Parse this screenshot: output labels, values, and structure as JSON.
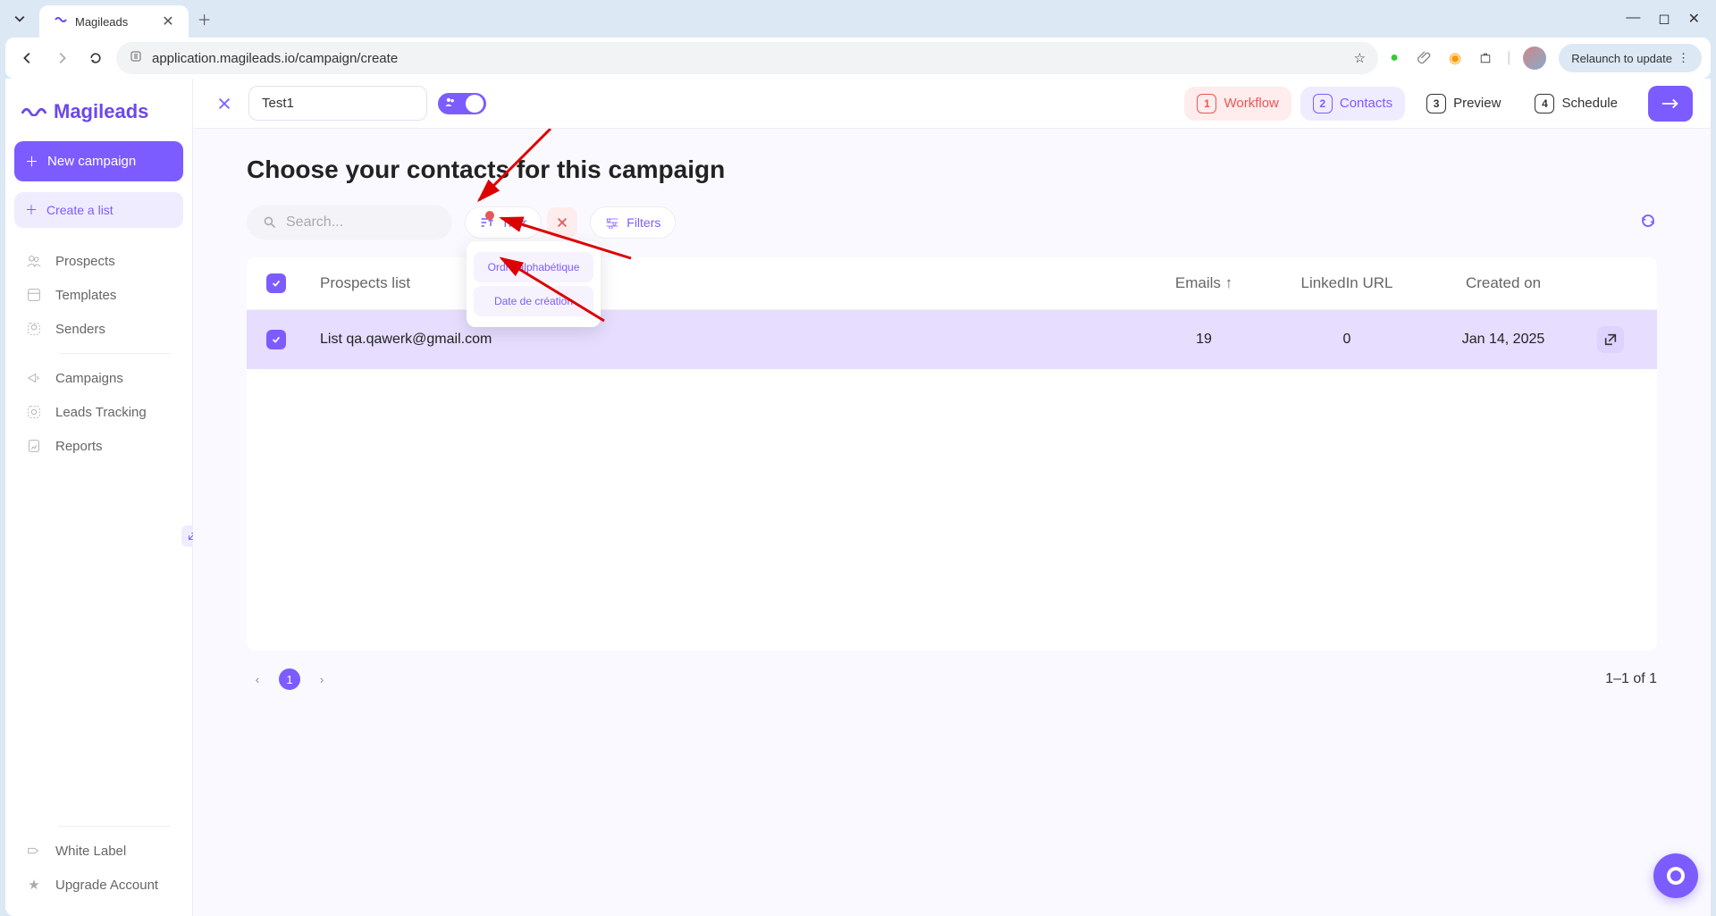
{
  "browser": {
    "tabTitle": "Magileads",
    "url": "application.magileads.io/campaign/create",
    "relaunch": "Relaunch to update"
  },
  "logo": {
    "text": "Magileads"
  },
  "sidebar": {
    "newCampaign": "New campaign",
    "createList": "Create a list",
    "items": [
      {
        "label": "Prospects"
      },
      {
        "label": "Templates"
      },
      {
        "label": "Senders"
      },
      {
        "label": "Campaigns"
      },
      {
        "label": "Leads Tracking"
      },
      {
        "label": "Reports"
      }
    ],
    "bottom": [
      {
        "label": "White Label"
      },
      {
        "label": "Upgrade Account"
      }
    ]
  },
  "campaign": {
    "name": "Test1"
  },
  "steps": {
    "workflow": "Workflow",
    "contacts": "Contacts",
    "preview": "Preview",
    "schedule": "Schedule"
  },
  "page": {
    "title": "Choose your contacts for this campaign",
    "searchPlaceholder": "Search...",
    "sortLabel": "Trier",
    "filtersLabel": "Filters",
    "sortOptions": [
      "Ordre alphabétique",
      "Date de création"
    ]
  },
  "table": {
    "headers": {
      "name": "Prospects list",
      "emails": "Emails ↑",
      "linkedin": "LinkedIn URL",
      "created": "Created on"
    },
    "rows": [
      {
        "name": "List qa.qawerk@gmail.com",
        "emails": "19",
        "linkedin": "0",
        "created": "Jan 14, 2025"
      }
    ]
  },
  "pagination": {
    "current": "1",
    "info": "1–1 of 1"
  }
}
